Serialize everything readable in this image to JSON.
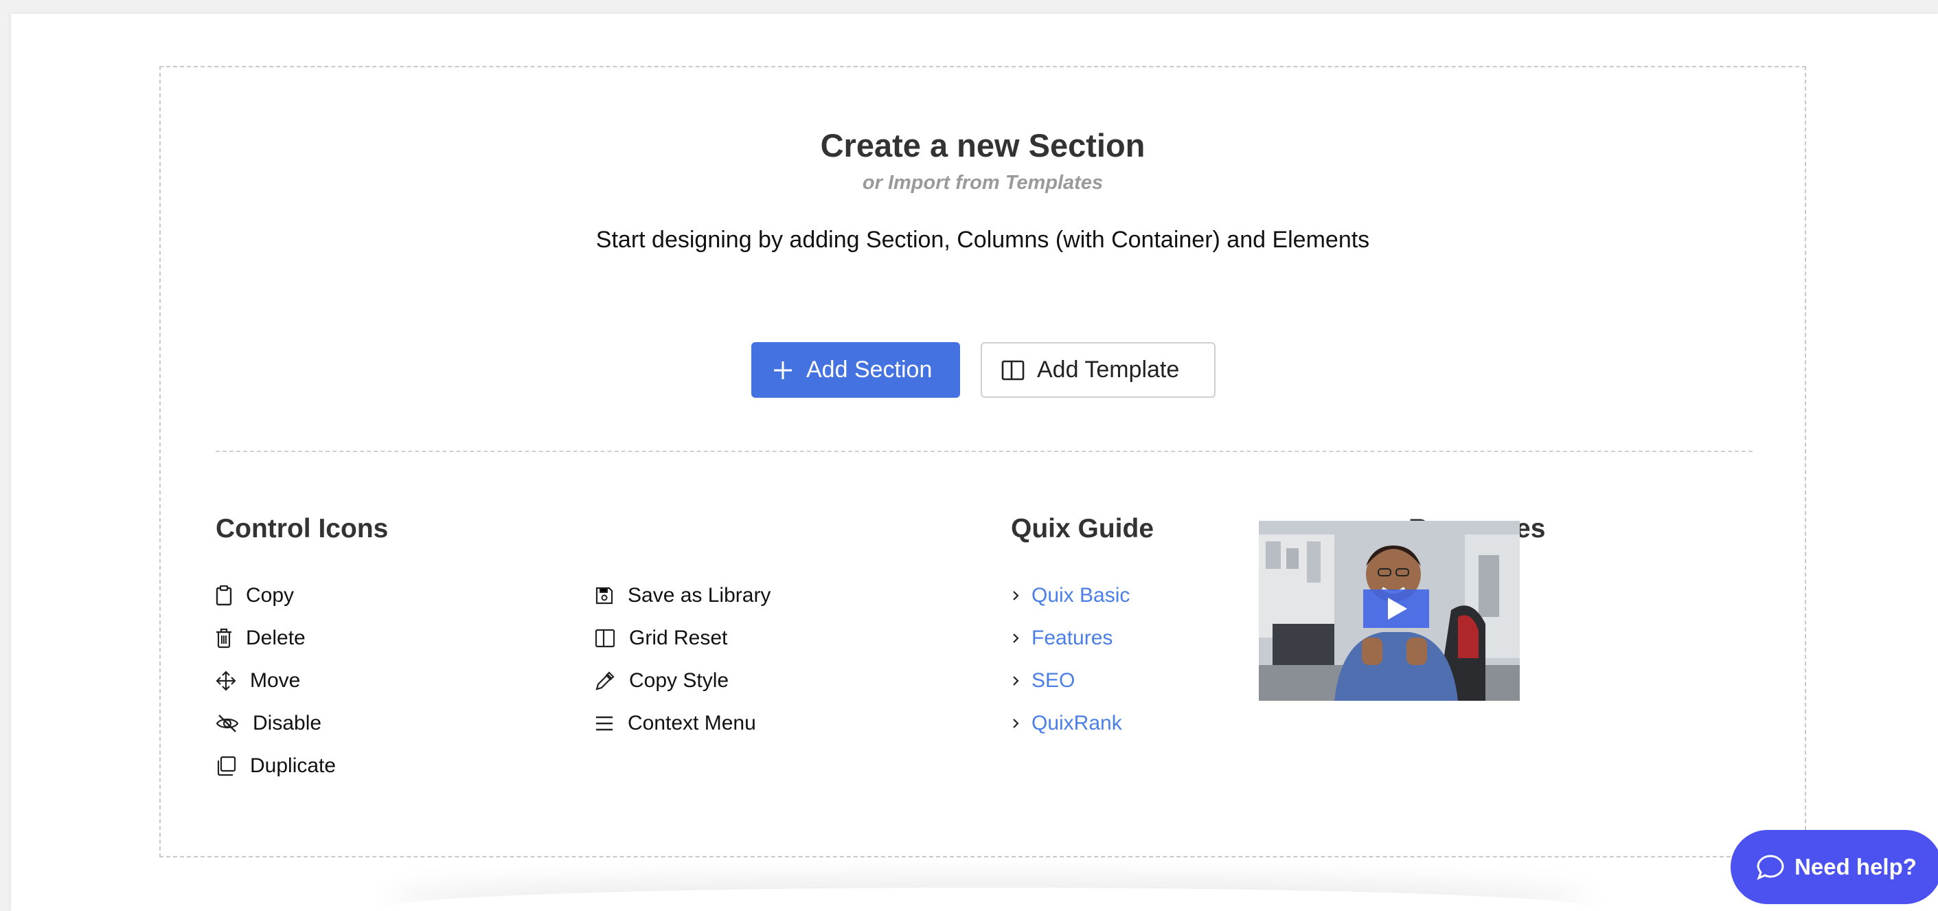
{
  "header": {
    "title": "Create a new Section",
    "subtitle": "or Import from Templates",
    "description": "Start designing by adding Section, Columns (with Container) and Elements"
  },
  "actions": {
    "add_section": "Add Section",
    "add_template": "Add Template"
  },
  "control_icons": {
    "heading": "Control Icons",
    "left": [
      {
        "label": "Copy",
        "icon": "clipboard-icon"
      },
      {
        "label": "Delete",
        "icon": "trash-icon"
      },
      {
        "label": "Move",
        "icon": "move-icon"
      },
      {
        "label": "Disable",
        "icon": "eye-off-icon"
      },
      {
        "label": "Duplicate",
        "icon": "duplicate-icon"
      }
    ],
    "right": [
      {
        "label": "Save as Library",
        "icon": "save-icon"
      },
      {
        "label": "Grid Reset",
        "icon": "columns-icon"
      },
      {
        "label": "Copy Style",
        "icon": "eyedropper-icon"
      },
      {
        "label": "Context Menu",
        "icon": "menu-icon"
      }
    ]
  },
  "guide": {
    "heading": "Quix Guide",
    "links": [
      "Quix Basic",
      "Features",
      "SEO",
      "QuixRank"
    ]
  },
  "resources": {
    "heading": "Resources"
  },
  "help": {
    "label": "Need help?"
  },
  "colors": {
    "primary": "#4472e0",
    "link": "#4b7fe6",
    "help": "#4b52f0"
  }
}
